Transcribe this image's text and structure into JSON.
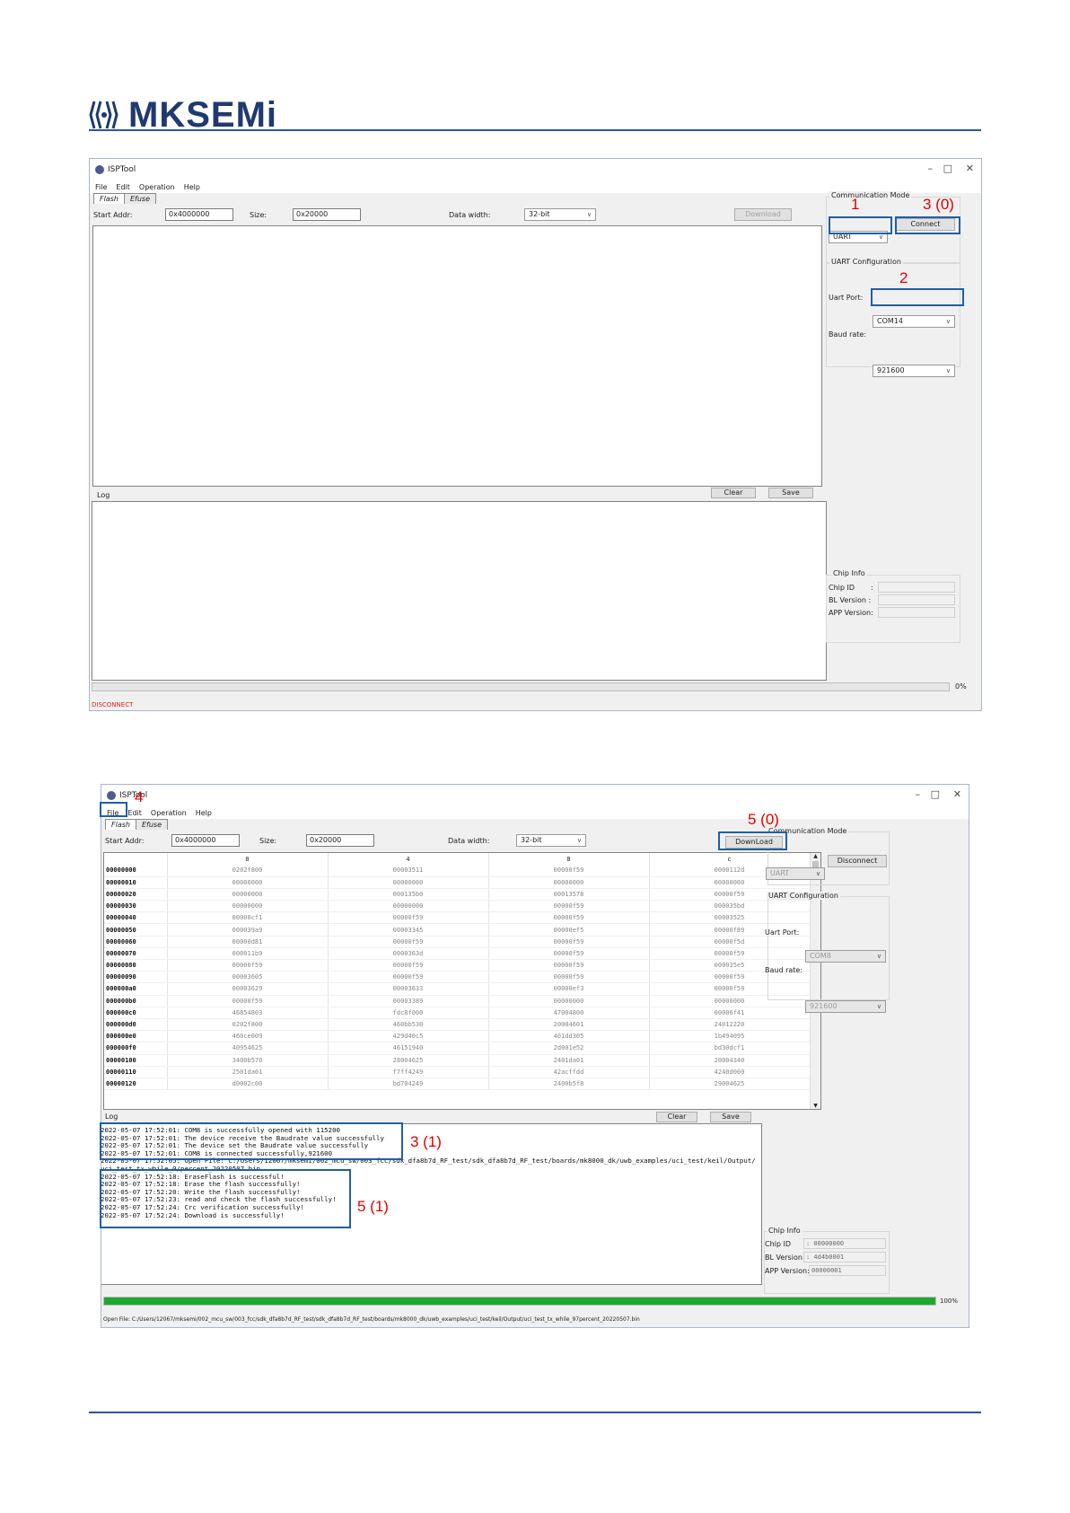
{
  "brand": {
    "name": "MKSEMi",
    "color": "#1f3a6e",
    "line_color": "#2f5597"
  },
  "annotation_color": "#e00000",
  "highlight_color": "#1f5fa8",
  "window1": {
    "title": "ISPTool",
    "menu": [
      "File",
      "Edit",
      "Operation",
      "Help"
    ],
    "tabs": [
      "Flash",
      "Efuse"
    ],
    "start_addr_label": "Start Addr:",
    "start_addr_value": "0x4000000",
    "size_label": "Size:",
    "size_value": "0x20000",
    "data_width_label": "Data width:",
    "data_width_value": "32-bit",
    "download_label": "Download",
    "comm_mode_title": "Communication Mode",
    "comm_mode_value": "UART",
    "connect_label": "Connect",
    "uart_config_title": "UART Configuration",
    "uart_port_label": "Uart Port:",
    "uart_port_value": "COM14",
    "baud_label": "Baud rate:",
    "baud_value": "921600",
    "log_label": "Log",
    "clear_label": "Clear",
    "save_label": "Save",
    "chip_info_title": "Chip Info",
    "chip_id_label": "Chip ID",
    "bl_version_label": "BL Version :",
    "app_version_label": "APP Version:",
    "progress_text": "0%",
    "progress": 0,
    "status": "DISCONNECT",
    "annotations": {
      "a1": "1",
      "a2": "2",
      "a3": "3 (0)"
    }
  },
  "window2": {
    "title": "ISPTool",
    "menu": [
      "File",
      "Edit",
      "Operation",
      "Help"
    ],
    "tabs": [
      "Flash",
      "Efuse"
    ],
    "start_addr_label": "Start Addr:",
    "start_addr_value": "0x4000000",
    "size_label": "Size:",
    "size_value": "0x20000",
    "data_width_label": "Data width:",
    "data_width_value": "32-bit",
    "download_label": "DownLoad",
    "comm_mode_title": "Communication Mode",
    "comm_mode_value": "UART",
    "disconnect_label": "Disconnect",
    "uart_config_title": "UART Configuration",
    "uart_port_label": "Uart Port:",
    "uart_port_value": "COM8",
    "baud_label": "Baud rate:",
    "baud_value": "921600",
    "grid_headers": [
      "",
      "0",
      "4",
      "8",
      "c"
    ],
    "grid_rows": [
      [
        "00000000",
        "0202f800",
        "00003511",
        "00000f59",
        "0000112d"
      ],
      [
        "00000010",
        "00000000",
        "00000000",
        "00000000",
        "00000000"
      ],
      [
        "00000020",
        "00000000",
        "000135b0",
        "00013578",
        "00000f59"
      ],
      [
        "00000030",
        "00000000",
        "00000000",
        "00000f59",
        "000035bd"
      ],
      [
        "00000040",
        "00000cf1",
        "00000f59",
        "00000f59",
        "00003525"
      ],
      [
        "00000050",
        "000039a9",
        "00003345",
        "00000ef5",
        "00000f89"
      ],
      [
        "00000060",
        "00000d81",
        "00000f59",
        "00000f59",
        "00000f5d"
      ],
      [
        "00000070",
        "000011b9",
        "0000363d",
        "00000f59",
        "00000f59"
      ],
      [
        "00000080",
        "00000f59",
        "00000f59",
        "00000f59",
        "000035e5"
      ],
      [
        "00000090",
        "00003605",
        "00000f59",
        "00000f59",
        "00000f59"
      ],
      [
        "000000a0",
        "00003629",
        "00003633",
        "00000ef3",
        "00000f59"
      ],
      [
        "000000b0",
        "00000f59",
        "00003389",
        "00000000",
        "00000000"
      ],
      [
        "000000c0",
        "46854803",
        "fdc8f000",
        "47004800",
        "00006f41"
      ],
      [
        "000000d0",
        "0202f800",
        "460bb530",
        "20004601",
        "24012220"
      ],
      [
        "000000e0",
        "460ce009",
        "429d40c5",
        "401dd305",
        "1b494095"
      ],
      [
        "000000f0",
        "40954625",
        "46151940",
        "2d001e52",
        "bd30dcf1"
      ],
      [
        "00000100",
        "3400b570",
        "28004625",
        "2401da01",
        "20004340"
      ],
      [
        "00000110",
        "2501da01",
        "f7ff4249",
        "42acffdd",
        "4240d000"
      ],
      [
        "00000120",
        "d0002c00",
        "bd704249",
        "2400b5f8",
        "29004625"
      ]
    ],
    "log_label": "Log",
    "clear_label": "Clear",
    "save_label": "Save",
    "log_lines": [
      "2022-05-07 17:52:01: COM8 is successfully opened with 115200",
      "2022-05-07 17:52:01: The device receive the Baudrate value successfully",
      "2022-05-07 17:52:01: The device set the Baudrate value successfully",
      "2022-05-07 17:52:01: COM8 is connected successfully,921600",
      "2022-05-07 17:52:05: Open File: C:/Users/12067/mksemi/002_mcu_sw/003_fcc/sdk_dfa8b7d_RF_test/sdk_dfa8b7d_RF_test/boards/mk8000_dk/uwb_examples/uci_test/keil/Output/",
      "uci_test_tx_while_0/percent_20220507.bin",
      "2022-05-07 17:52:18: EraseFlash is successful!",
      "2022-05-07 17:52:18: Erase the flash successfully!",
      "2022-05-07 17:52:20: Write the flash successfully!",
      "2022-05-07 17:52:23: read and check the flash successfully!",
      "2022-05-07 17:52:24: Crc verification successfully!",
      "2022-05-07 17:52:24: Download is successfully!"
    ],
    "chip_info_title": "Chip Info",
    "chip_id_label": "Chip ID",
    "chip_id_value": ": 00000000",
    "bl_version_label": "BL Version",
    "bl_version_value": ": 4d4b0001",
    "app_version_label": "APP Version:",
    "app_version_value": "00000001",
    "progress_text": "100%",
    "progress": 1,
    "progress_color": "#1fa830",
    "status": "Open File: C:/Users/12067/mksemi/002_mcu_sw/003_fcc/sdk_dfa8b7d_RF_test/sdk_dfa8b7d_RF_test/boards/mk8000_dk/uwb_examples/uci_test/keil/Output/uci_test_tx_while_97percent_20220507.bin",
    "annotations": {
      "a4": "4",
      "a5_0": "5 (0)",
      "a3_1": "3 (1)",
      "a5_1": "5 (1)"
    }
  }
}
